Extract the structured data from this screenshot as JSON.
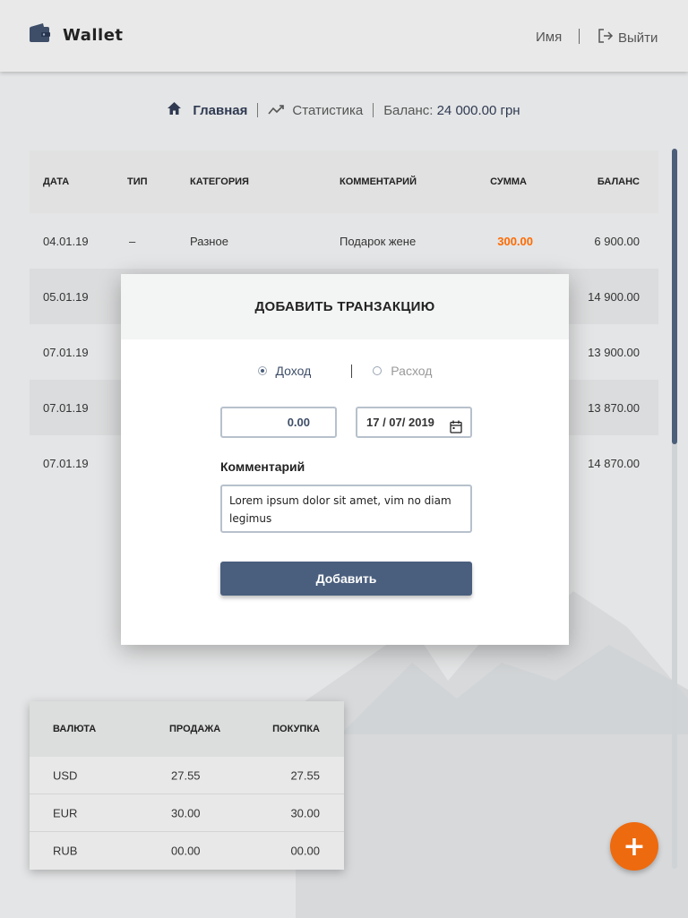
{
  "header": {
    "logo_text": "Wallet",
    "user_name": "Имя",
    "logout_label": "Выйти"
  },
  "nav": {
    "home_label": "Главная",
    "stats_label": "Статистика",
    "balance_label": "Баланс:",
    "balance_value": "24 000.00 грн"
  },
  "transactions": {
    "headers": [
      "ДАТА",
      "ТИП",
      "КАТЕГОРИЯ",
      "КОММЕНТАРИЙ",
      "СУММА",
      "БАЛАНС"
    ],
    "rows": [
      {
        "date": "04.01.19",
        "type": "–",
        "category": "Разное",
        "comment": "Подарок жене",
        "sum": "300.00",
        "balance": "6 900.00"
      },
      {
        "date": "05.01.19",
        "type": "",
        "category": "",
        "comment": "",
        "sum": "",
        "balance": "14 900.00"
      },
      {
        "date": "07.01.19",
        "type": "",
        "category": "",
        "comment": "",
        "sum": "",
        "balance": "13 900.00"
      },
      {
        "date": "07.01.19",
        "type": "",
        "category": "",
        "comment": "",
        "sum": "",
        "balance": "13 870.00"
      },
      {
        "date": "07.01.19",
        "type": "",
        "category": "",
        "comment": "",
        "sum": "",
        "balance": "14 870.00"
      }
    ]
  },
  "modal": {
    "title": "ДОБАВИТЬ ТРАНЗАКЦИЮ",
    "radio_income": "Доход",
    "radio_expense": "Расход",
    "selected": "income",
    "amount_value": "0.00",
    "date_value": "17 / 07/ 2019",
    "comment_label": "Комментарий",
    "comment_value": "Lorem ipsum dolor sit amet, vim no diam legimus",
    "submit_label": "Добавить"
  },
  "currency": {
    "headers": [
      "ВАЛЮТА",
      "ПРОДАЖА",
      "ПОКУПКА"
    ],
    "rows": [
      {
        "code": "USD",
        "sell": "27.55",
        "buy": "27.55"
      },
      {
        "code": "EUR",
        "sell": "30.00",
        "buy": "30.00"
      },
      {
        "code": "RUB",
        "sell": "00.00",
        "buy": "00.00"
      }
    ]
  },
  "fab": {
    "icon": "plus-icon",
    "label": "+"
  },
  "colors": {
    "accent": "#ee6a0e",
    "primary": "#4a5f7e",
    "negative_sum": "#ff6a00",
    "background": "#e4e5e6"
  },
  "icons": [
    "wallet-icon",
    "logout-icon",
    "home-icon",
    "chart-line-icon",
    "calendar-icon",
    "plus-icon"
  ]
}
